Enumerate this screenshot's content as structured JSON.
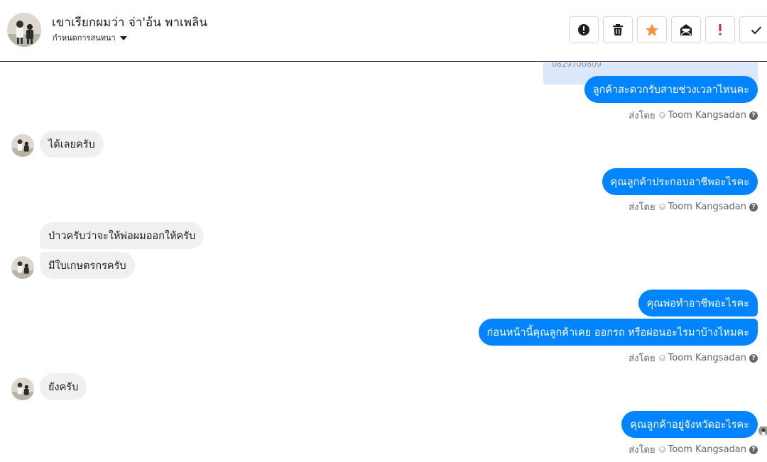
{
  "header": {
    "contact_name": "เขาเรียกผมว่า จ่า'อ้น พาเพลิน",
    "subtitle": "กำหนดการสนทนา",
    "avatar_icon": "profile-photo",
    "tools": [
      {
        "name": "mark-spam-button",
        "icon": "exclamation-circle-icon"
      },
      {
        "name": "delete-button",
        "icon": "trash-icon"
      },
      {
        "name": "star-button",
        "icon": "star-icon",
        "color": "#f7923b"
      },
      {
        "name": "mark-unread-button",
        "icon": "envelope-open-icon"
      },
      {
        "name": "follow-up-button",
        "icon": "exclamation-icon",
        "color": "#e41e3f"
      },
      {
        "name": "mark-done-button",
        "icon": "check-icon"
      }
    ]
  },
  "quoted_number": "0829700809",
  "messages": {
    "m1": "ลูกค้าสะดวกรับสายช่วงเวลาไหนคะ",
    "m2": "ได้เลยครับ",
    "m3": "คุณลูกค้าประกอบอาชีพอะไรคะ",
    "m4": "ป่าวครับว่าจะให้พ่อผมออกให้ครับ",
    "m5": "มีใบเกษตรกรครับ",
    "m6": "คุณพ่อทำอาชีพอะไรคะ",
    "m7": "ก่อนหน้านี้คุณลูกค้าเคย ออกรถ หรือผ่อนอะไรมาบ้างไหมคะ",
    "m8": "ยังครับ",
    "m9": "คุณลูกค้าอยู่จังหวัดอะไรคะ"
  },
  "sent_by": {
    "label": "ส่งโดย",
    "agent": "Toom Kangsadan",
    "help": "?"
  },
  "colors": {
    "outgoing": "#0084ff",
    "incoming": "#f1f0f0",
    "quoted": "#dbe8fb"
  }
}
